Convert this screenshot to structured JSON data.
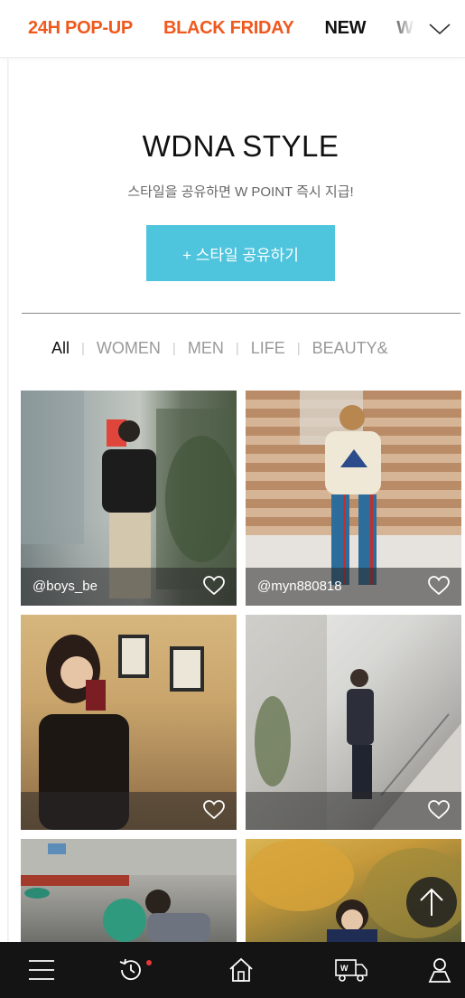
{
  "topnav": {
    "items": [
      {
        "label": "24H POP-UP",
        "color": "#f0591e"
      },
      {
        "label": "BLACK FRIDAY",
        "color": "#f0591e"
      },
      {
        "label": "NEW",
        "color": "#111111"
      },
      {
        "label": "W",
        "color": "#111111"
      }
    ],
    "toggle_icon": "chevron-down-icon"
  },
  "hero": {
    "title": "WDNA STYLE",
    "subtitle": "스타일을 공유하면 W POINT 즉시 지급!",
    "share_button": "+ 스타일 공유하기",
    "accent": "#4fc4dd"
  },
  "categories": {
    "items": [
      "All",
      "WOMEN",
      "MEN",
      "LIFE",
      "BEAUTY&"
    ],
    "active": "All"
  },
  "grid": {
    "tiles": [
      {
        "handle": "@boys_be"
      },
      {
        "handle": "@myn880818"
      },
      {
        "handle": ""
      },
      {
        "handle": ""
      },
      {
        "handle": ""
      },
      {
        "handle": ""
      }
    ]
  },
  "bottom_nav": {
    "items": [
      "menu-icon",
      "history-icon",
      "home-icon",
      "delivery-truck-icon",
      "user-icon"
    ],
    "background": "#141414"
  },
  "scroll_top_icon": "arrow-up-icon"
}
